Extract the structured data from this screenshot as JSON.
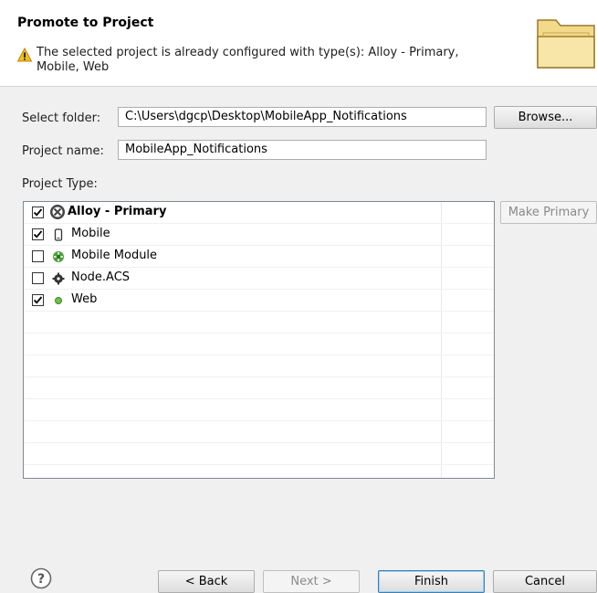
{
  "header": {
    "title": "Promote to Project",
    "message_line1": "The selected project is already configured with type(s): Alloy - Primary,",
    "message_line2": "Mobile, Web",
    "warning_icon": "warning-icon",
    "banner_icon": "folder-icon"
  },
  "form": {
    "select_folder_label": "Select folder:",
    "select_folder_value": "C:\\Users\\dgcp\\Desktop\\MobileApp_Notifications",
    "browse_label": "Browse...",
    "project_name_label": "Project name:",
    "project_name_value": "MobileApp_Notifications",
    "project_type_label": "Project Type:",
    "make_primary_label": "Make Primary"
  },
  "project_types": [
    {
      "label": "Alloy - Primary",
      "checked": true,
      "icon": "alloy-icon",
      "primary": true
    },
    {
      "label": "Mobile",
      "checked": true,
      "icon": "mobile-icon",
      "primary": false
    },
    {
      "label": "Mobile Module",
      "checked": false,
      "icon": "mobile-module-icon",
      "primary": false
    },
    {
      "label": "Node.ACS",
      "checked": false,
      "icon": "node-acs-icon",
      "primary": false
    },
    {
      "label": "Web",
      "checked": true,
      "icon": "web-icon",
      "primary": false
    }
  ],
  "footer": {
    "help_icon": "help-icon",
    "back_label": "< Back",
    "next_label": "Next >",
    "finish_label": "Finish",
    "cancel_label": "Cancel"
  },
  "colors": {
    "dialog_bg": "#f0f0f0",
    "header_bg": "#ffffff",
    "warning": "#f2c019",
    "folder": "#e9c46a",
    "disabled_text": "#8a8a8a"
  }
}
